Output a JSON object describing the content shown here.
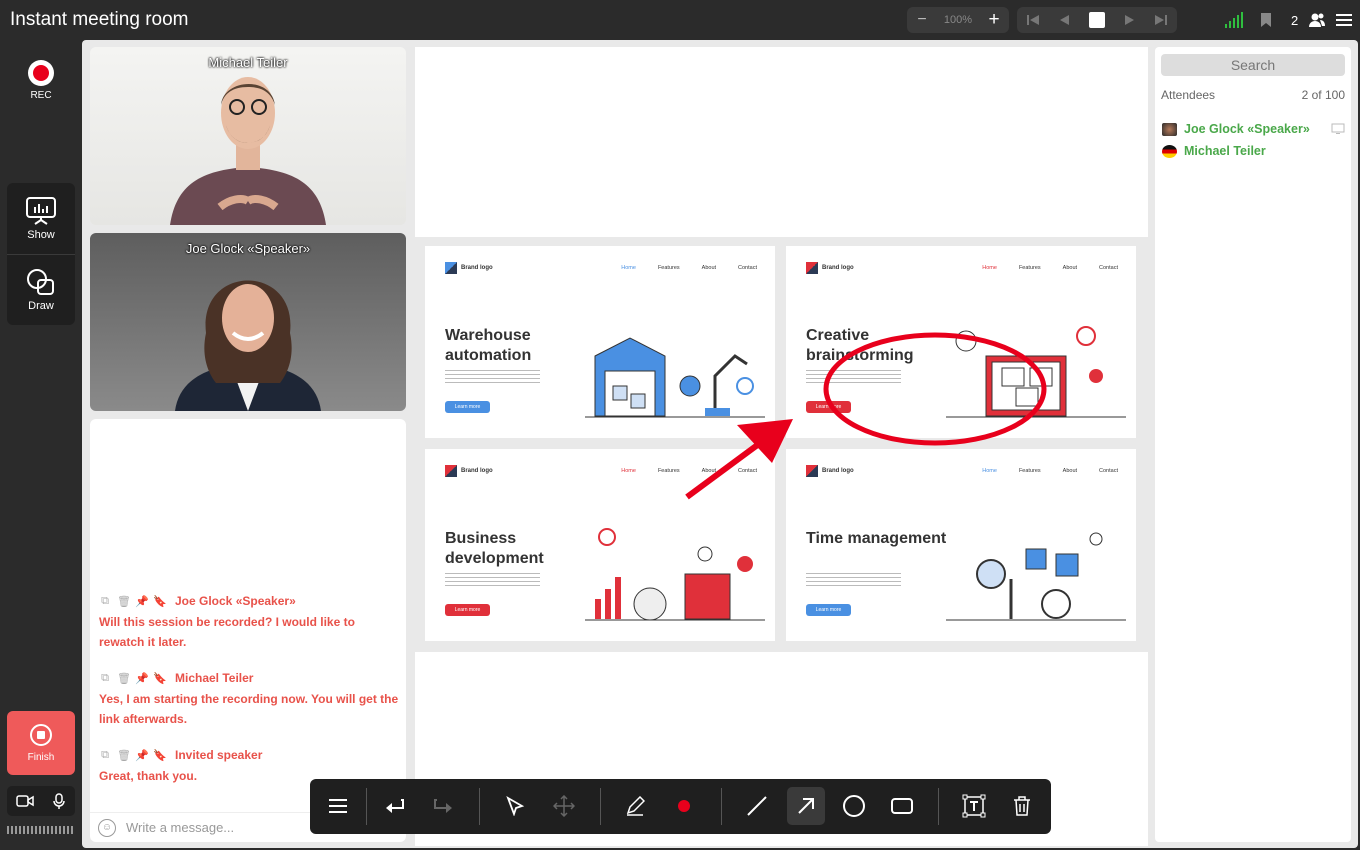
{
  "header": {
    "title": "Instant meeting room",
    "zoom": "100%",
    "attendee_count": "2"
  },
  "left": {
    "rec_label": "REC",
    "show_label": "Show",
    "draw_label": "Draw",
    "finish_label": "Finish"
  },
  "videos": [
    {
      "name": "Michael Teiler"
    },
    {
      "name": "Joe Glock «Speaker»"
    }
  ],
  "chat": {
    "messages": [
      {
        "author": "Joe Glock «Speaker»",
        "text": "Will this session be recorded? I would like to rewatch it later."
      },
      {
        "author": "Michael Teiler",
        "text": "Yes, I am starting the recording now. You will get the link afterwards."
      },
      {
        "author": "Invited speaker",
        "text": "Great, thank you."
      }
    ],
    "placeholder": "Write a message..."
  },
  "slides": [
    {
      "title": "Warehouse automation",
      "button": "Learn more",
      "accent": "#4a90e2"
    },
    {
      "title": "Creative brainstorming",
      "button": "Learn more",
      "accent": "#e0303a"
    },
    {
      "title": "Business development",
      "button": "Learn more",
      "accent": "#e0303a"
    },
    {
      "title": "Time management",
      "button": "Learn more",
      "accent": "#4a90e2"
    }
  ],
  "slide_common": {
    "brand": "Brand logo",
    "nav": [
      "Home",
      "Features",
      "About",
      "Contact"
    ]
  },
  "attendees": {
    "search": "Search",
    "label": "Attendees",
    "count": "2 of 100",
    "list": [
      {
        "name": "Joe Glock «Speaker»"
      },
      {
        "name": "Michael Teiler"
      }
    ]
  },
  "colors": {
    "accent_red": "#e8001c",
    "attendee_green": "#4aa84a",
    "chat_red": "#e8524a",
    "finish": "#ef5a5a"
  }
}
